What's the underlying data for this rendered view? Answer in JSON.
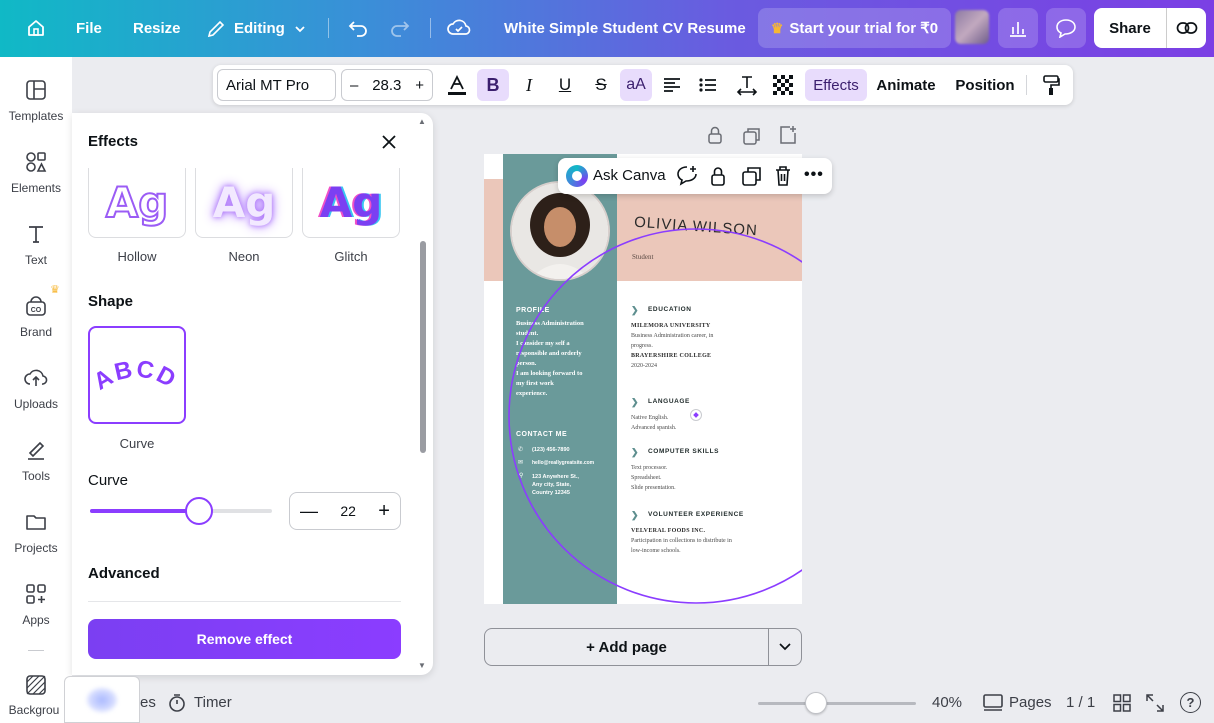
{
  "topbar": {
    "file": "File",
    "resize": "Resize",
    "editing": "Editing",
    "doc_title": "White Simple Student CV Resume",
    "trial": "Start your trial for ₹0",
    "share": "Share"
  },
  "rail": {
    "items": [
      {
        "label": "Templates",
        "icon": "templates-icon"
      },
      {
        "label": "Elements",
        "icon": "elements-icon"
      },
      {
        "label": "Text",
        "icon": "text-icon"
      },
      {
        "label": "Brand",
        "icon": "brand-icon"
      },
      {
        "label": "Uploads",
        "icon": "uploads-icon"
      },
      {
        "label": "Tools",
        "icon": "tools-icon"
      },
      {
        "label": "Projects",
        "icon": "projects-icon"
      },
      {
        "label": "Apps",
        "icon": "apps-icon"
      }
    ],
    "background_partial": "Backgrou"
  },
  "toolbar": {
    "font": "Arial MT Pro",
    "size": "28.3",
    "effects": "Effects",
    "animate": "Animate",
    "position": "Position"
  },
  "panel": {
    "title": "Effects",
    "styles": [
      {
        "label": "Hollow",
        "sample": "Ag"
      },
      {
        "label": "Neon",
        "sample": "Ag"
      },
      {
        "label": "Glitch",
        "sample": "Ag"
      }
    ],
    "shape_heading": "Shape",
    "shape_sample": "ABCD",
    "shape_label": "Curve",
    "curve_label": "Curve",
    "curve_value": "22",
    "curve_fraction": 0.6,
    "advanced_heading": "Advanced",
    "remove_button": "Remove effect"
  },
  "canvas": {
    "ask_canva": "Ask Canva",
    "resume": {
      "name": "OLIVIA WILSON",
      "role": "Student",
      "profile_heading": "PROFILE",
      "profile_lines": [
        "Business Administration",
        "student.",
        "I consider my self a",
        "responsible and orderly",
        "person.",
        "I am looking forward to",
        "my first work",
        "experience."
      ],
      "contact_heading": "CONTACT ME",
      "phone": "(123) 456-7890",
      "email": "hello@reallygreatsite.com",
      "address_lines": [
        "123 Anywhere St.,",
        "Any city, State,",
        "Country 12345"
      ],
      "sections": [
        {
          "heading": "EDUCATION",
          "lines": [
            {
              "text": "MILEMORA UNIVERSITY",
              "bold": true
            },
            {
              "text": "Business Administration career, in",
              "bold": false
            },
            {
              "text": "progress.",
              "bold": false
            },
            {
              "text": "BRAYERSHIRE COLLEGE",
              "bold": true
            },
            {
              "text": "2020-2024",
              "bold": false
            }
          ]
        },
        {
          "heading": "LANGUAGE",
          "lines": [
            {
              "text": "Native English.",
              "bold": false
            },
            {
              "text": "Advanced spanish.",
              "bold": false
            }
          ]
        },
        {
          "heading": "COMPUTER SKILLS",
          "lines": [
            {
              "text": "Text processor.",
              "bold": false
            },
            {
              "text": "Spreadsheet.",
              "bold": false
            },
            {
              "text": "Slide presentation.",
              "bold": false
            }
          ]
        },
        {
          "heading": "VOLUNTEER EXPERIENCE",
          "lines": [
            {
              "text": "VELVERAL FOODS INC.",
              "bold": true
            },
            {
              "text": "Participation in collections to distribute in",
              "bold": false
            },
            {
              "text": "low-income schools.",
              "bold": false
            }
          ]
        }
      ]
    },
    "add_page": "+ Add page"
  },
  "bottombar": {
    "notes_partial": "es",
    "timer": "Timer",
    "zoom": "40%",
    "zoom_fraction": 0.37,
    "pages": "Pages",
    "page_count": "1 / 1"
  },
  "colors": {
    "accent": "#8b3dff",
    "sidebar_teal": "#6a9a9a",
    "header_pink": "#ebc7ba"
  }
}
